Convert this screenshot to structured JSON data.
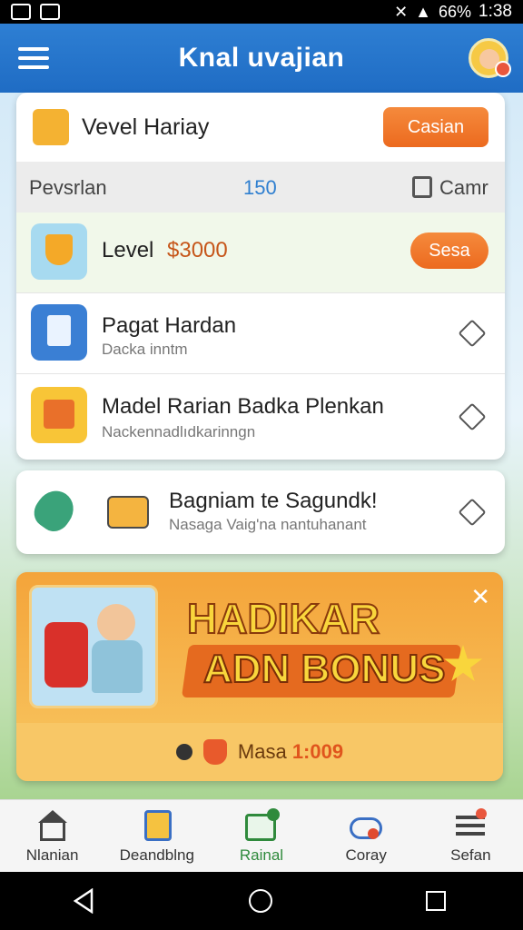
{
  "status_bar": {
    "battery": "66%",
    "time": "1:38"
  },
  "header": {
    "title": "Knal uvajian"
  },
  "main_card": {
    "header_row": {
      "title": "Vevel Hariay",
      "button": "Casian"
    },
    "info_row": {
      "left": "Pevsrlan",
      "value": "150",
      "right": "Camr"
    },
    "level_row": {
      "label": "Level",
      "amount": "$3000",
      "button": "Sesa"
    },
    "task1": {
      "title": "Pagat Hardan",
      "subtitle": "Dacka inntm"
    },
    "task2": {
      "title": "Madel Rarian Badka Plenkan",
      "subtitle": "Nackennadlıdkarinngn"
    }
  },
  "second_card": {
    "title": "Bagniam te Sagundk!",
    "subtitle": "Nasaga Vaig'na nantuhanant"
  },
  "bonus": {
    "title_line1": "HADIKAR",
    "title_line2": "ADN BONUS",
    "footer_label": "Masa",
    "footer_value": "1:009",
    "close": "✕"
  },
  "bottom_nav": [
    {
      "label": "Nlanian"
    },
    {
      "label": "Deandblng"
    },
    {
      "label": "Rainal"
    },
    {
      "label": "Coray"
    },
    {
      "label": "Sefan"
    }
  ],
  "colors": {
    "header": "#2370c8",
    "accent_orange": "#ef6f22",
    "active_nav": "#2f8a3c"
  }
}
